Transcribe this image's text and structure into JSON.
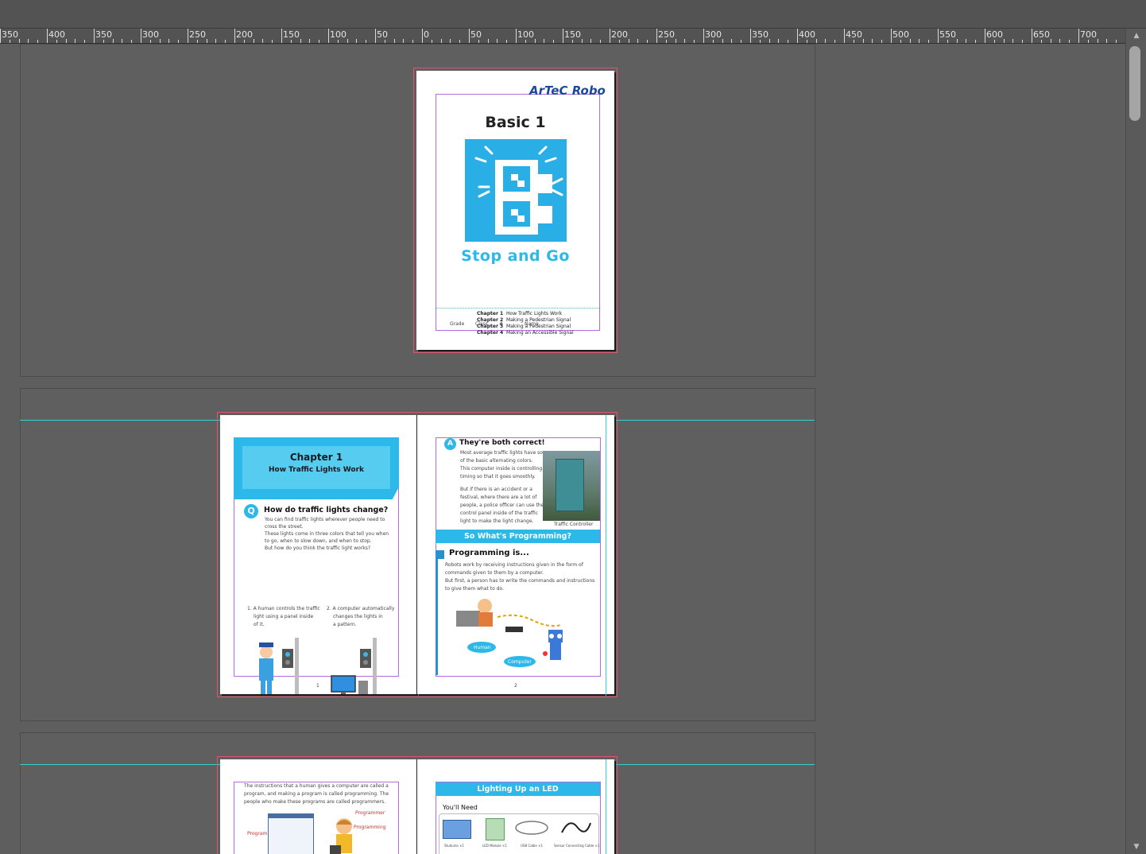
{
  "ruler": {
    "labels": [
      "350",
      "400",
      "350",
      "300",
      "250",
      "200",
      "150",
      "100",
      "50",
      "0",
      "50",
      "100",
      "150",
      "200",
      "250",
      "300",
      "350",
      "400",
      "450",
      "500",
      "550",
      "600",
      "650",
      "700",
      "7"
    ]
  },
  "cover": {
    "logo_text": "ArTeC Robo",
    "title": "Basic 1",
    "subtitle": "Stop and Go",
    "chapters": [
      {
        "num": "Chapter 1",
        "name": "How Traffic Lights Work"
      },
      {
        "num": "Chapter 2",
        "name": "Making a Pedestrian Signal"
      },
      {
        "num": "Chapter 3",
        "name": "Making a Pedestrian Signal"
      },
      {
        "num": "Chapter 4",
        "name": "Making an Accessible Signal"
      }
    ],
    "footer": {
      "grade": "Grade",
      "class": "Class",
      "no": "#",
      "name": "Name"
    }
  },
  "spread1": {
    "left": {
      "chapter": "Chapter 1",
      "chapter_title": "How Traffic Lights Work",
      "question": "How do traffic lights change?",
      "question_badge": "Q",
      "body": [
        "You can find traffic lights wherever people need to",
        "cross the street.",
        "These lights come in three colors that tell you when",
        "to go, when to slow down, and when to stop.",
        "But how do you think the traffic light works?"
      ],
      "option1": [
        "1. A human controls the traffic",
        "light using a panel inside",
        "of it."
      ],
      "option2": [
        "2. A computer automatically",
        "changes the lights in",
        "a pattern."
      ],
      "page_number": "1"
    },
    "right": {
      "answer_badge": "A",
      "answer": "They're both correct!",
      "body1": [
        "Most average traffic lights have some",
        "of the basic alternating colors.",
        "This computer inside is controlling",
        "timing so that it goes smoothly."
      ],
      "body2": [
        "But if there is an accident or a",
        "festival, where there are a lot of",
        "people, a police officer can use the",
        "control panel inside of the traffic",
        "light to make the light change."
      ],
      "photo_caption": "Traffic Controller",
      "section_banner": "So What's Programming?",
      "heading": "Programming is...",
      "text": [
        "Robots work by receiving instructions given in the form of",
        "commands given to them by a computer.",
        "But first, a person has to write the commands and instructions",
        "to give them what to do."
      ],
      "label_human": "Human",
      "label_computer": "Computer",
      "page_number": "2"
    }
  },
  "spread2": {
    "left": {
      "text": [
        "The instructions that a human gives a computer are called a",
        "program, and making a program is called programming. The",
        "people who make these programs are called programmers."
      ],
      "label_program": "Program",
      "label_programmer": "Programmer",
      "label_programming": "Programming"
    },
    "right": {
      "banner": "Lighting Up an LED",
      "need_heading": "You'll Need",
      "items": [
        "Studuino ×1",
        "LED Module ×1",
        "USB Cable ×1",
        "Sensor Connecting Cable ×1"
      ]
    }
  },
  "colors": {
    "accent": "#2cb8e8",
    "page_border": "#e0556b",
    "margin_guide": "#b36be0",
    "guide": "#35d0d0",
    "pasteboard": "#5f5f5f"
  }
}
